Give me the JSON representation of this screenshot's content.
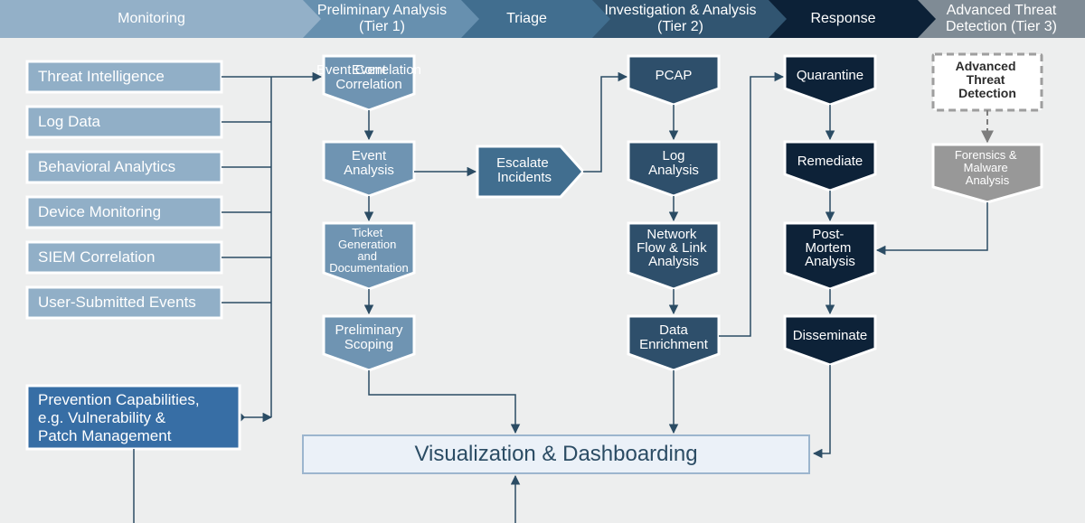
{
  "header": [
    "Monitoring",
    "Preliminary Analysis (Tier 1)",
    "Triage",
    "Investigation & Analysis (Tier 2)",
    "Response",
    "Advanced Threat Detection (Tier 3)"
  ],
  "monitoring_sources": [
    "Threat Intelligence",
    "Log Data",
    "Behavioral Analytics",
    "Device Monitoring",
    "SIEM Correlation",
    "User-Submitted Events"
  ],
  "prevention": {
    "line1": "Prevention Capabilities,",
    "line2": "e.g. Vulnerability &",
    "line3": "Patch Management"
  },
  "tier1": {
    "event_correlation": "Event Correlation",
    "event_analysis": "Event Analysis",
    "ticket_l1": "Ticket",
    "ticket_l2": "Generation",
    "ticket_l3": "and",
    "ticket_l4": "Documentation",
    "preliminary_scoping": "Preliminary Scoping"
  },
  "triage": {
    "escalate_l1": "Escalate",
    "escalate_l2": "Incidents"
  },
  "tier2": {
    "pcap": "PCAP",
    "log_analysis": "Log Analysis",
    "netflow_l1": "Network",
    "netflow_l2": "Flow & Link",
    "netflow_l3": "Analysis",
    "data_enrichment": "Data Enrichment"
  },
  "response": {
    "quarantine": "Quarantine",
    "remediate": "Remediate",
    "postmortem_l1": "Post-",
    "postmortem_l2": "Mortem",
    "postmortem_l3": "Analysis",
    "disseminate": "Disseminate"
  },
  "tier3": {
    "atd_l1": "Advanced",
    "atd_l2": "Threat",
    "atd_l3": "Detection",
    "forensics_l1": "Forensics &",
    "forensics_l2": "Malware",
    "forensics_l3": "Analysis"
  },
  "viz": "Visualization & Dashboarding"
}
